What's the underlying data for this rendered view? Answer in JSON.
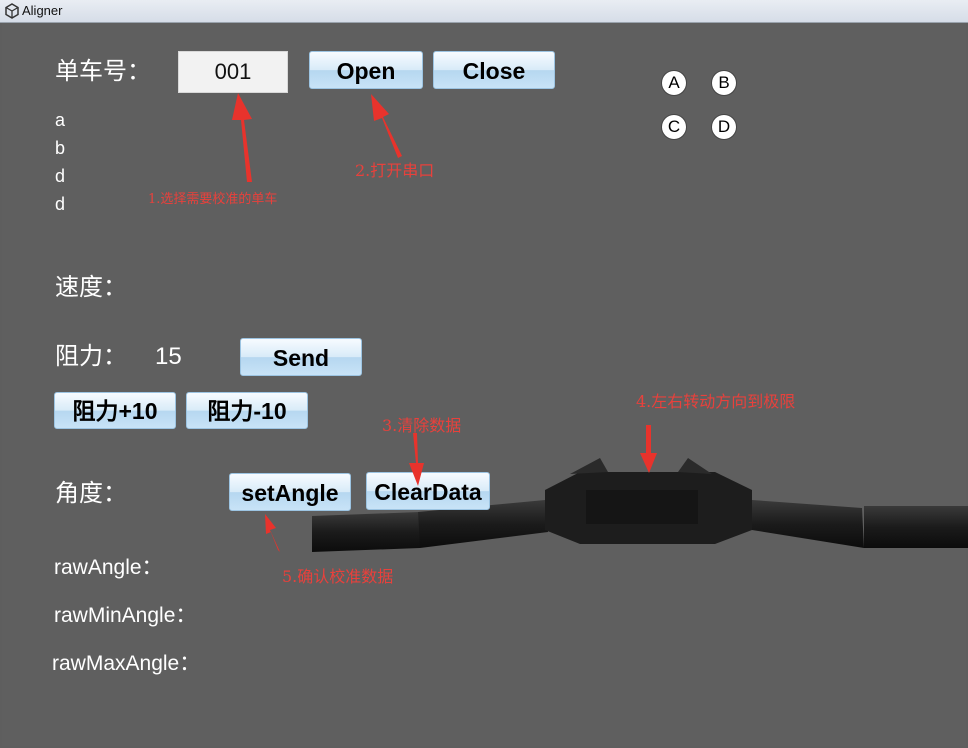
{
  "window": {
    "title": "Aligner"
  },
  "bike": {
    "label": "单车号：",
    "value": "001",
    "open_label": "Open",
    "close_label": "Close"
  },
  "status_lines": [
    "a",
    "b",
    "d",
    "d"
  ],
  "radios": [
    "A",
    "B",
    "C",
    "D"
  ],
  "speed": {
    "label": "速度："
  },
  "resistance": {
    "label": "阻力：",
    "value": "15",
    "send_label": "Send",
    "plus_label": "阻力+10",
    "minus_label": "阻力-10"
  },
  "angle": {
    "label": "角度：",
    "set_label": "setAngle",
    "clear_label": "ClearData"
  },
  "raw": {
    "raw_angle": "rawAngle：",
    "raw_min": "rawMinAngle：",
    "raw_max": "rawMaxAngle："
  },
  "annotations": {
    "a1": "1.选择需要校准的单车",
    "a2": "2.打开串口",
    "a3": "3.清除数据",
    "a4": "4.左右转动方向到极限",
    "a5": "5.确认校准数据"
  },
  "colors": {
    "background": "#5f5f5f",
    "annotation": "#e8413c",
    "button": "#cfe6f8"
  }
}
